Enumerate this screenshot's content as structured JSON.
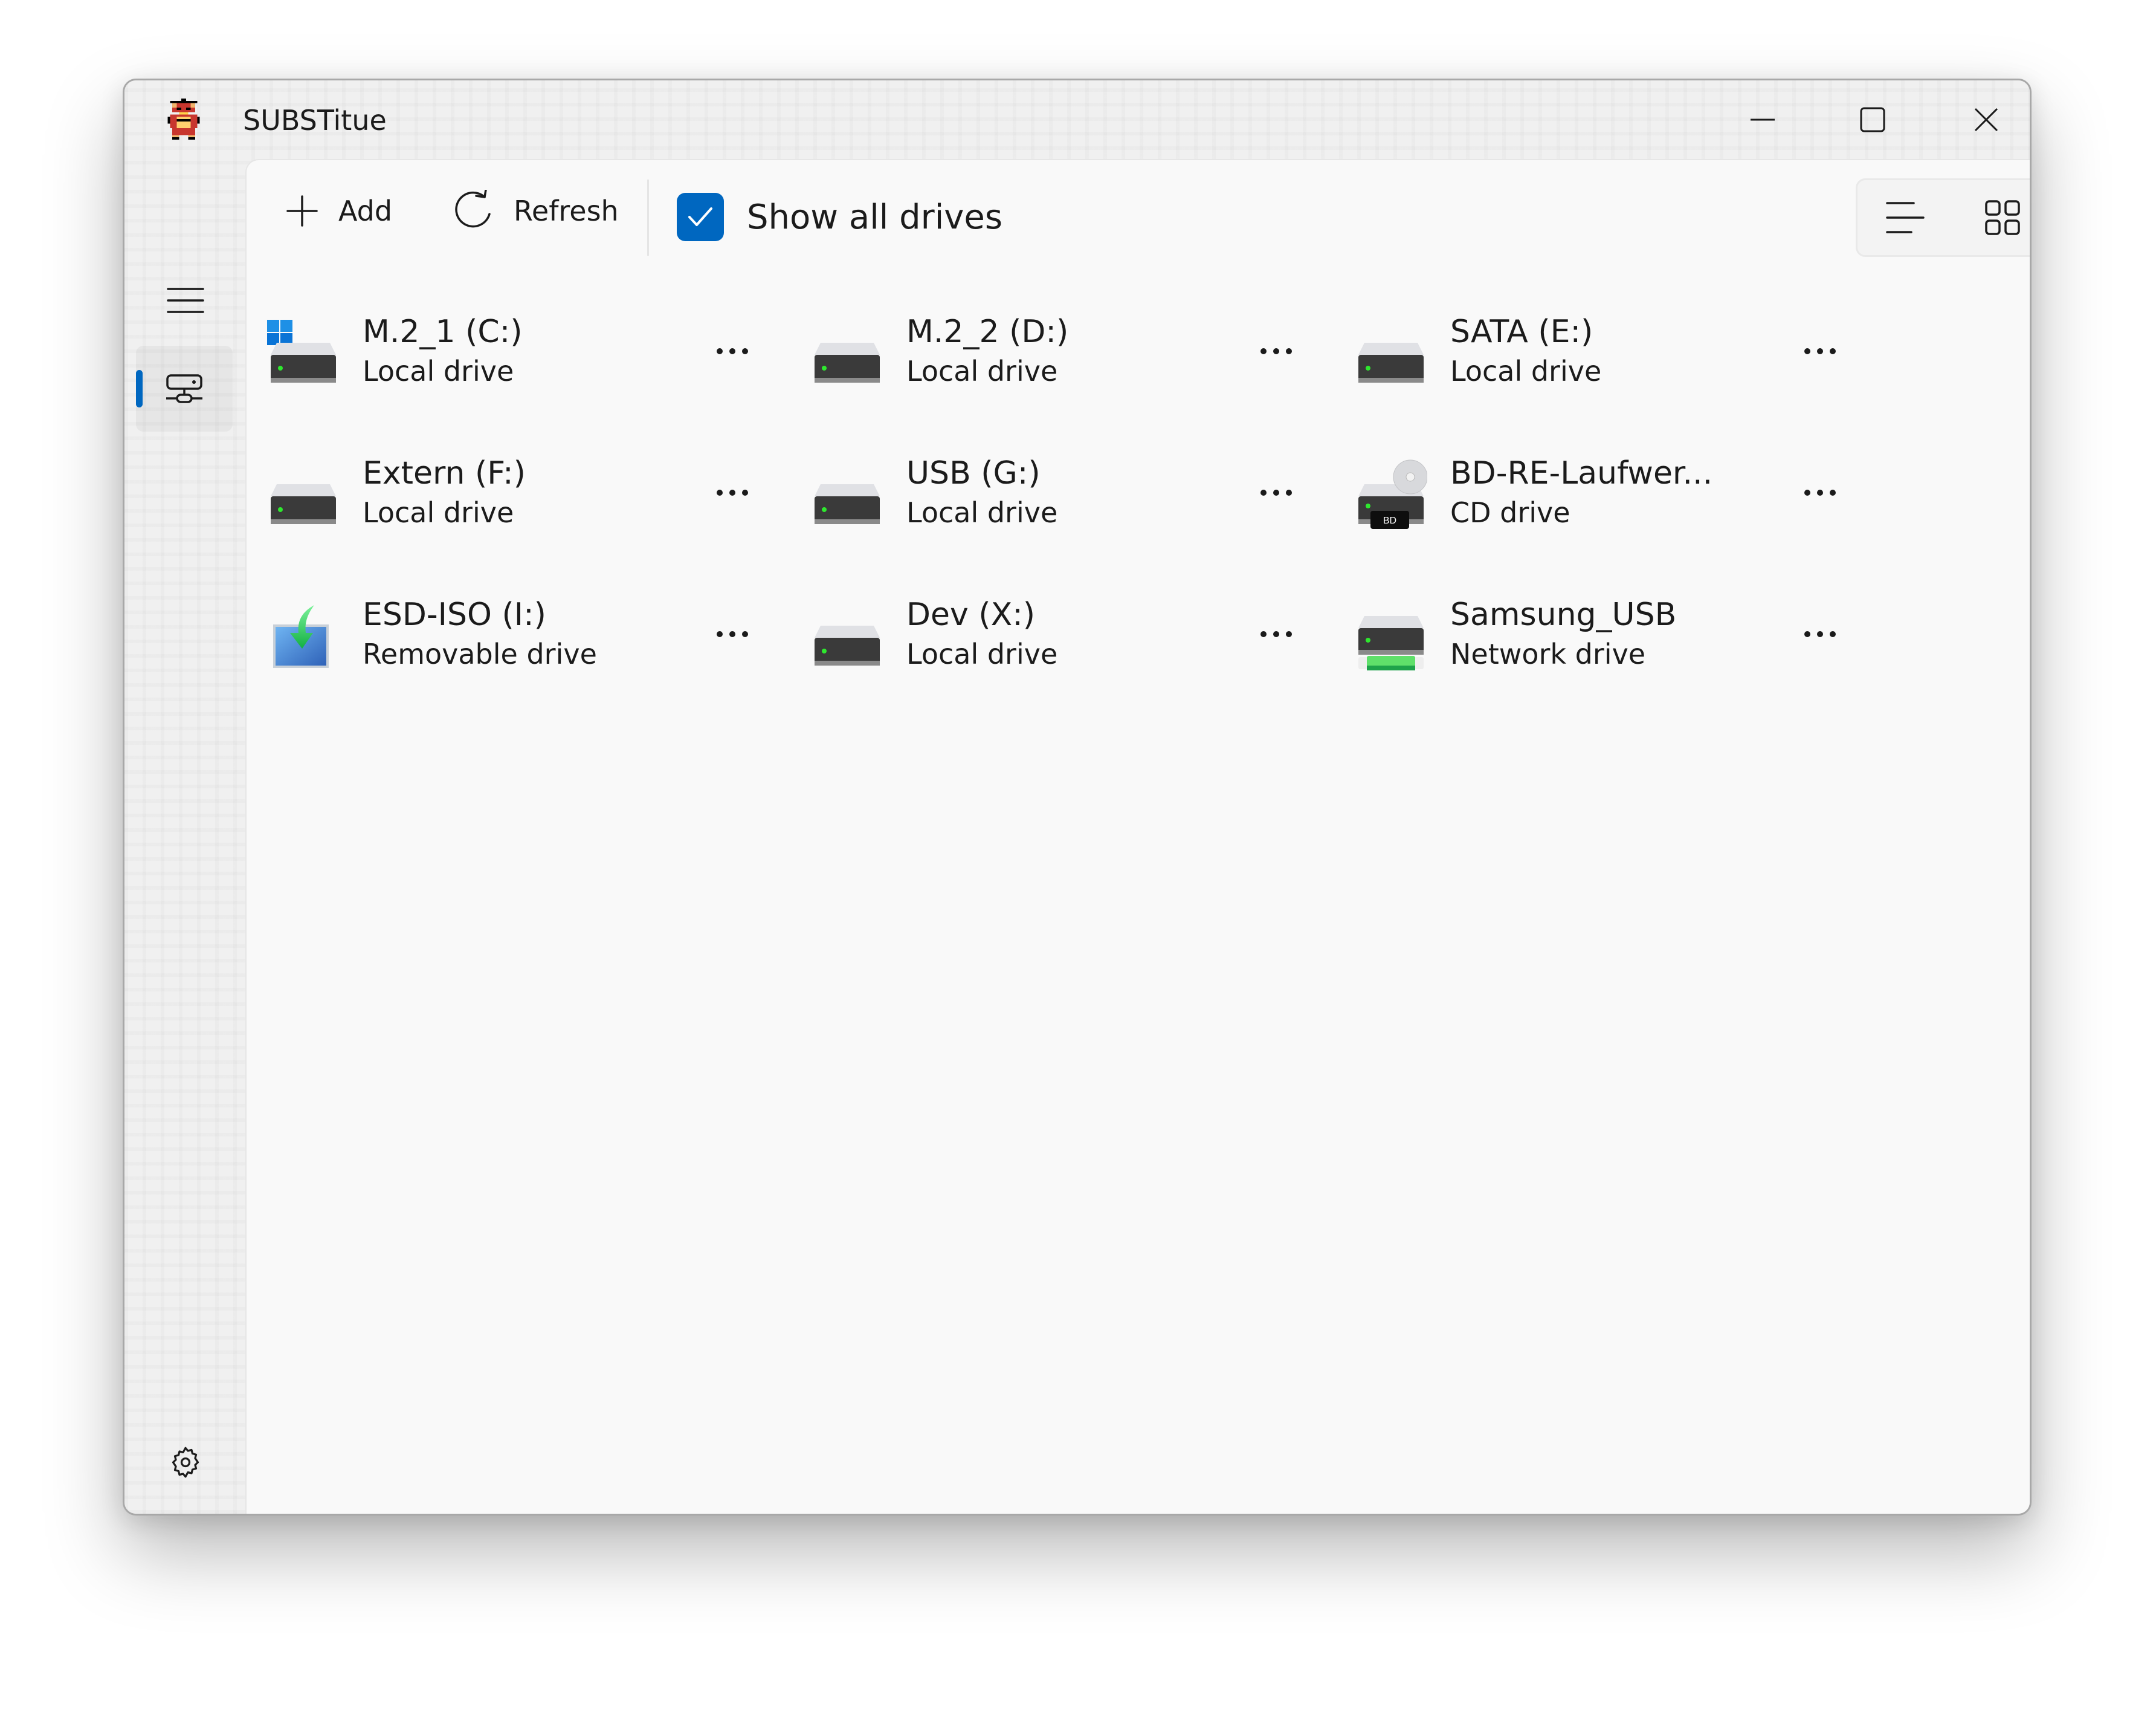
{
  "window": {
    "title": "SUBSTitue",
    "app_icon": "pixel-dragon-icon",
    "caption_buttons": {
      "minimize": "minimize-icon",
      "maximize": "maximize-icon",
      "close": "close-icon"
    }
  },
  "sidebar": {
    "menu_icon": "hamburger-menu-icon",
    "items": [
      {
        "id": "drives",
        "icon": "network-drive-icon",
        "selected": true
      }
    ],
    "footer_icon": "settings-gear-icon"
  },
  "toolbar": {
    "add_label": "Add",
    "refresh_label": "Refresh",
    "show_all": {
      "label": "Show all drives",
      "checked": true
    },
    "view_modes": [
      {
        "id": "list",
        "icon": "list-view-icon",
        "selected": false
      },
      {
        "id": "tiles",
        "icon": "tiles-view-icon",
        "selected": false
      },
      {
        "id": "grid",
        "icon": "grid-view-icon",
        "selected": true
      }
    ]
  },
  "drives": [
    {
      "name": "M.2_1 (C:)",
      "type": "Local drive",
      "icon": "system-drive-icon"
    },
    {
      "name": "M.2_2 (D:)",
      "type": "Local drive",
      "icon": "hard-drive-icon"
    },
    {
      "name": "SATA (E:)",
      "type": "Local drive",
      "icon": "hard-drive-icon"
    },
    {
      "name": "Extern (F:)",
      "type": "Local drive",
      "icon": "hard-drive-icon"
    },
    {
      "name": "USB (G:)",
      "type": "Local drive",
      "icon": "hard-drive-icon"
    },
    {
      "name": "BD-RE-Laufwer...",
      "type": "CD drive",
      "icon": "bd-drive-icon",
      "badge": "BD"
    },
    {
      "name": "ESD-ISO (I:)",
      "type": "Removable drive",
      "icon": "removable-drive-icon"
    },
    {
      "name": "Dev (X:)",
      "type": "Local drive",
      "icon": "hard-drive-icon"
    },
    {
      "name": "Samsung_USB",
      "type": "Network drive",
      "icon": "network-drive-icon"
    }
  ],
  "colors": {
    "accent": "#0067c0",
    "led": "#2ee82e",
    "network_bar": "#5fe06a"
  }
}
